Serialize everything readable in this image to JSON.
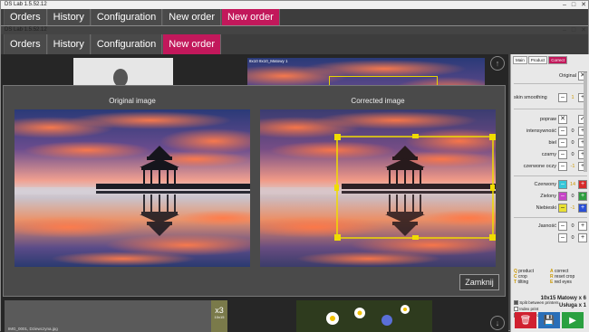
{
  "win1": {
    "title": "DS Lab 1.5.52.12",
    "tabs": [
      "Orders",
      "History",
      "Configuration",
      "New order",
      "New order"
    ]
  },
  "win2": {
    "title": "DS Lab 1.5.52.12",
    "tabs": [
      "Orders",
      "History",
      "Configuration",
      "New order"
    ]
  },
  "modal": {
    "left_title": "Original image",
    "right_title": "Corrected image",
    "close_label": "Zamknij"
  },
  "side": {
    "tabs": [
      "Main",
      "Product",
      "Correct"
    ],
    "original_label": "Original",
    "smoothing_label": "skin smoothing",
    "smoothing_val": "1",
    "rows": [
      {
        "label": "popraw",
        "val": ""
      },
      {
        "label": "intensywność",
        "val": "0"
      },
      {
        "label": "biel",
        "val": "0"
      },
      {
        "label": "czarny",
        "val": "0"
      },
      {
        "label": "czerwone oczy",
        "val": "-1"
      }
    ],
    "colors": [
      {
        "label": "Czerwony",
        "val": "14",
        "color": "#d52b2b",
        "sw": "#35c6d8"
      },
      {
        "label": "Zielony",
        "val": "0",
        "color": "#2e9e3e",
        "sw": "#c745c7"
      },
      {
        "label": "Niebieski",
        "val": "-1",
        "color": "#2b4fd5",
        "sw": "#e8e033"
      }
    ],
    "jasnosc_label": "Jasność",
    "jasnosc_val": "0",
    "contrast_val": "0",
    "shortcuts": [
      {
        "k": "Q",
        "t": "product",
        "k2": "A",
        "t2": "correct"
      },
      {
        "k": "C",
        "t": "crop",
        "k2": "R",
        "t2": "reset crop"
      },
      {
        "k": "T",
        "t": "tilting",
        "k2": "E",
        "t2": "red eyes"
      }
    ],
    "checks": [
      "Split between printers",
      "Index print",
      "Priority order"
    ],
    "summary_line1": "10x15 Matowy x 6",
    "summary_line2": "Usługa x 1"
  },
  "workspace": {
    "thumb_caption": "8x10 8x10_Matowy 1",
    "badge": "x3",
    "badge_sub": "10x15",
    "caption_bottom_left": "IMG_0001, Dziewczyna.jpg"
  }
}
